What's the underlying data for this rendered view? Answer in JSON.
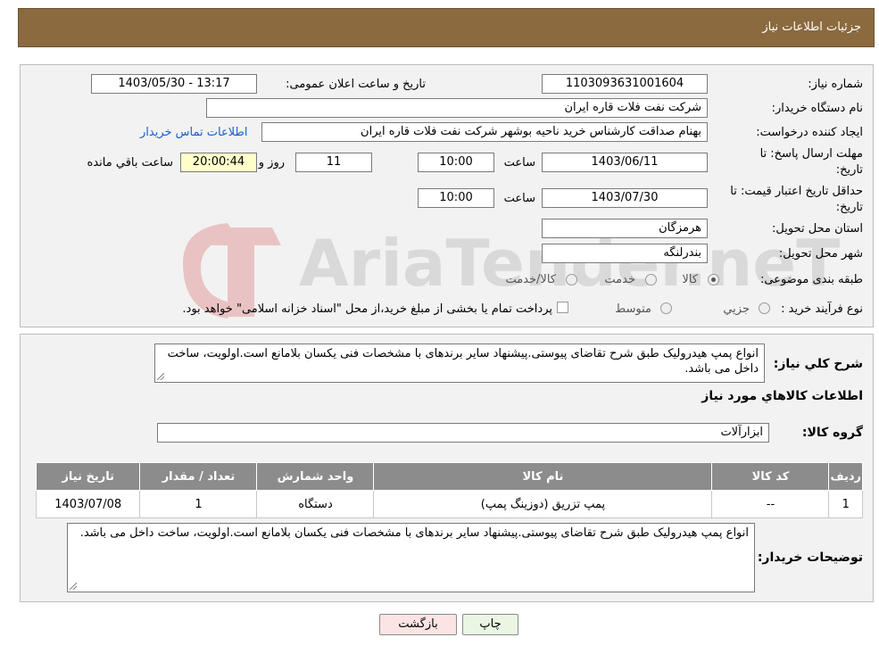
{
  "header": {
    "title": "جزئیات اطلاعات نیاز"
  },
  "form": {
    "need_number_label": "شماره نیاز:",
    "need_number": "1103093631001604",
    "announce_label": "تاریخ و ساعت اعلان عمومی:",
    "announce_value": "1403/05/30 - 13:17",
    "buyer_label": "نام دستگاه خریدار:",
    "buyer_value": "شرکت نفت فلات قاره ایران",
    "creator_label": "ایجاد کننده درخواست:",
    "creator_value": "بهنام  صداقت کارشناس خرید ناحیه بوشهر شرکت نفت فلات قاره ایران",
    "contact_link": "اطلاعات تماس خریدار",
    "deadline_label_1": "مهلت ارسال پاسخ: تا",
    "deadline_label_2": "تاریخ:",
    "deadline_date": "1403/06/11",
    "time_label": "ساعت",
    "deadline_time": "10:00",
    "days_value": "11",
    "days_label": "روز و",
    "remaining_value": "20:00:44",
    "remaining_label": "ساعت باقي مانده",
    "validity_label_1": "حداقل تاریخ اعتبار قیمت: تا",
    "validity_label_2": "تاریخ:",
    "validity_date": "1403/07/30",
    "validity_time": "10:00",
    "province_label": "استان محل تحویل:",
    "province_value": "هرمزگان",
    "city_label": "شهر محل تحویل:",
    "city_value": "بندرلنگه",
    "category_label": "طبقه بندی موضوعی:",
    "category_options": [
      "کالا",
      "خدمت",
      "کالا/خدمت"
    ],
    "process_label": "نوع فرآیند خرید :",
    "process_options": [
      "جزيي",
      "متوسط"
    ],
    "process_note": "پرداخت تمام یا بخشی از مبلغ خرید،از محل \"اسناد خزانه اسلامی\" خواهد بود."
  },
  "details": {
    "summary_label": "شرح کلي نياز:",
    "summary_text": "انواع پمپ هیدرولیک طبق شرح تقاضای پیوستی.پیشنهاد سایر برندهای با مشخصات فنی یکسان بلامانع است.اولویت، ساخت داخل می باشد.",
    "goods_info_title": "اطلاعات کالاهاي مورد نياز",
    "group_label": "گروه کالا:",
    "group_value": "ابزارآلات",
    "table": {
      "headers": [
        "رديف",
        "کد کالا",
        "نام کالا",
        "واحد شمارش",
        "تعداد / مقدار",
        "تاریخ نیاز"
      ],
      "rows": [
        [
          "1",
          "--",
          "پمپ تزریق (دوزینگ پمپ)",
          "دستگاه",
          "1",
          "1403/07/08"
        ]
      ]
    },
    "buyer_notes_label": "توضیحات خریدار:",
    "buyer_notes_text": "انواع پمپ هیدرولیک طبق شرح تقاضای پیوستی.پیشنهاد سایر برندهای با مشخصات فنی یکسان بلامانع است.اولویت، ساخت داخل می باشد."
  },
  "buttons": {
    "print": "چاپ",
    "back": "بازگشت"
  },
  "watermark": {
    "text": "AriaTender.neT"
  },
  "colors": {
    "header_bg": "#8b6a3f",
    "table_header": "#8c8c8c",
    "back_button": "#fce4e4",
    "print_button": "#eaf6e3",
    "remaining_bg": "#ffffcc",
    "link": "#1a5ecb"
  }
}
